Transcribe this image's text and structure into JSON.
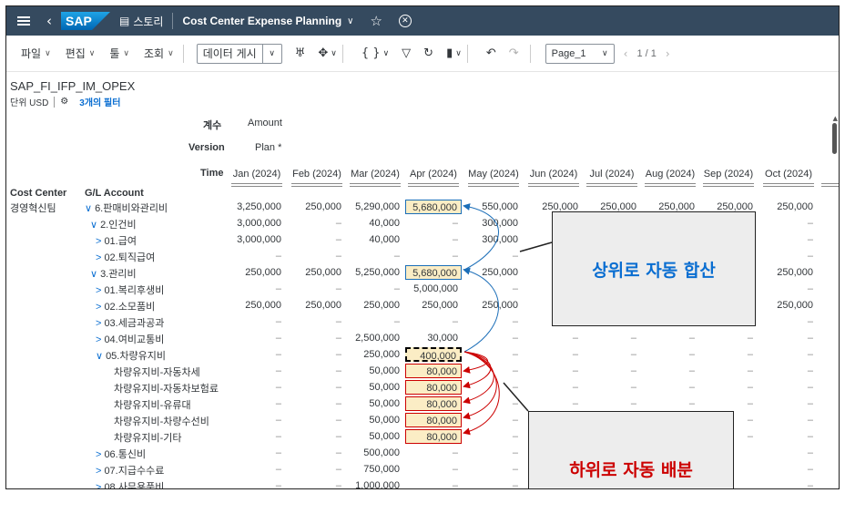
{
  "shell": {
    "logo": "SAP",
    "story_label": "스토리",
    "document_title": "Cost Center Expense Planning"
  },
  "toolbar": {
    "menus": [
      "파일",
      "편집",
      "툴",
      "조회"
    ],
    "data_entry": "데이터 게시",
    "page_select": "Page_1",
    "page_count": "1 / 1"
  },
  "model": {
    "name": "SAP_FI_IFP_IM_OPEX",
    "unit": "단위 USD",
    "filters": "3개의 필터"
  },
  "grid": {
    "measure_label": "계수",
    "measure_value": "Amount",
    "version_label": "Version",
    "version_value": "Plan *",
    "time_label": "Time",
    "cost_center_header": "Cost Center",
    "gl_header": "G/L Account",
    "months": [
      "Jan (2024)",
      "Feb (2024)",
      "Mar (2024)",
      "Apr (2024)",
      "May (2024)",
      "Jun (2024)",
      "Jul (2024)",
      "Aug (2024)",
      "Sep (2024)",
      "Oct (2024)",
      "Nov"
    ],
    "rows": [
      {
        "cc": "경영혁신팀",
        "toggle": "∨",
        "label": "6.판매비와관리비",
        "vals": [
          "3,250,000",
          "250,000",
          "5,290,000",
          "5,680,000",
          "550,000",
          "250,000",
          "250,000",
          "250,000",
          "250,000",
          "250,000",
          "2"
        ]
      },
      {
        "cc": "",
        "toggle": "∨",
        "label": "2.인건비",
        "vals": [
          "3,000,000",
          "–",
          "40,000",
          "–",
          "300,000",
          "",
          "",
          "",
          "",
          "–",
          ""
        ]
      },
      {
        "cc": "",
        "toggle": ">",
        "label": "01.급여",
        "vals": [
          "3,000,000",
          "–",
          "40,000",
          "–",
          "300,000",
          "",
          "",
          "",
          "",
          "–",
          ""
        ]
      },
      {
        "cc": "",
        "toggle": ">",
        "label": "02.퇴직급여",
        "vals": [
          "–",
          "–",
          "–",
          "–",
          "–",
          "",
          "",
          "",
          "",
          "–",
          ""
        ]
      },
      {
        "cc": "",
        "toggle": "∨",
        "label": "3.관리비",
        "vals": [
          "250,000",
          "250,000",
          "5,250,000",
          "5,680,000",
          "250,000",
          "25",
          "",
          "",
          "",
          "250,000",
          "2"
        ]
      },
      {
        "cc": "",
        "toggle": ">",
        "label": "01.복리후생비",
        "vals": [
          "–",
          "–",
          "–",
          "5,000,000",
          "–",
          "",
          "",
          "",
          "",
          "–",
          ""
        ]
      },
      {
        "cc": "",
        "toggle": ">",
        "label": "02.소모품비",
        "vals": [
          "250,000",
          "250,000",
          "250,000",
          "250,000",
          "250,000",
          "25",
          "",
          "",
          "",
          "250,000",
          "2"
        ]
      },
      {
        "cc": "",
        "toggle": ">",
        "label": "03.세금과공과",
        "vals": [
          "–",
          "–",
          "–",
          "–",
          "–",
          "",
          "",
          "",
          "",
          "–",
          ""
        ]
      },
      {
        "cc": "",
        "toggle": ">",
        "label": "04.여비교통비",
        "vals": [
          "–",
          "–",
          "2,500,000",
          "30,000",
          "–",
          "–",
          "–",
          "–",
          "–",
          "–",
          ""
        ]
      },
      {
        "cc": "",
        "toggle": "∨",
        "label": "05.차량유지비",
        "vals": [
          "–",
          "–",
          "250,000",
          "400,000",
          "–",
          "–",
          "–",
          "–",
          "–",
          "–",
          ""
        ]
      },
      {
        "cc": "",
        "toggle": "",
        "label": "차량유지비-자동차세",
        "vals": [
          "–",
          "–",
          "50,000",
          "80,000",
          "–",
          "–",
          "–",
          "–",
          "–",
          "–",
          ""
        ]
      },
      {
        "cc": "",
        "toggle": "",
        "label": "차량유지비-자동차보험료",
        "vals": [
          "–",
          "–",
          "50,000",
          "80,000",
          "–",
          "–",
          "–",
          "–",
          "–",
          "–",
          ""
        ]
      },
      {
        "cc": "",
        "toggle": "",
        "label": "차량유지비-유류대",
        "vals": [
          "–",
          "–",
          "50,000",
          "80,000",
          "–",
          "–",
          "–",
          "–",
          "–",
          "–",
          ""
        ]
      },
      {
        "cc": "",
        "toggle": "",
        "label": "차량유지비-차량수선비",
        "vals": [
          "–",
          "–",
          "50,000",
          "80,000",
          "–",
          "–",
          "–",
          "–",
          "–",
          "–",
          ""
        ]
      },
      {
        "cc": "",
        "toggle": "",
        "label": "차량유지비-기타",
        "vals": [
          "–",
          "–",
          "50,000",
          "80,000",
          "–",
          "–",
          "–",
          "–",
          "–",
          "–",
          ""
        ]
      },
      {
        "cc": "",
        "toggle": ">",
        "label": "06.통신비",
        "vals": [
          "–",
          "–",
          "500,000",
          "–",
          "–",
          "",
          "",
          "",
          "",
          "–",
          ""
        ]
      },
      {
        "cc": "",
        "toggle": ">",
        "label": "07.지급수수료",
        "vals": [
          "–",
          "–",
          "750,000",
          "–",
          "–",
          "",
          "",
          "",
          "",
          "–",
          ""
        ]
      },
      {
        "cc": "",
        "toggle": ">",
        "label": "08.사무용품비",
        "vals": [
          "–",
          "–",
          "1,000,000",
          "–",
          "–",
          "",
          "",
          "",
          "",
          "–",
          ""
        ]
      }
    ]
  },
  "callouts": {
    "up": "상위로 자동 합산",
    "down": "하위로 자동 배분"
  },
  "colors": {
    "shell": "#354a5f",
    "link": "#0a6ed1",
    "highlight_fill": "#fbedc5",
    "up_border": "#1b6eb8",
    "down_border": "#cc0000"
  }
}
